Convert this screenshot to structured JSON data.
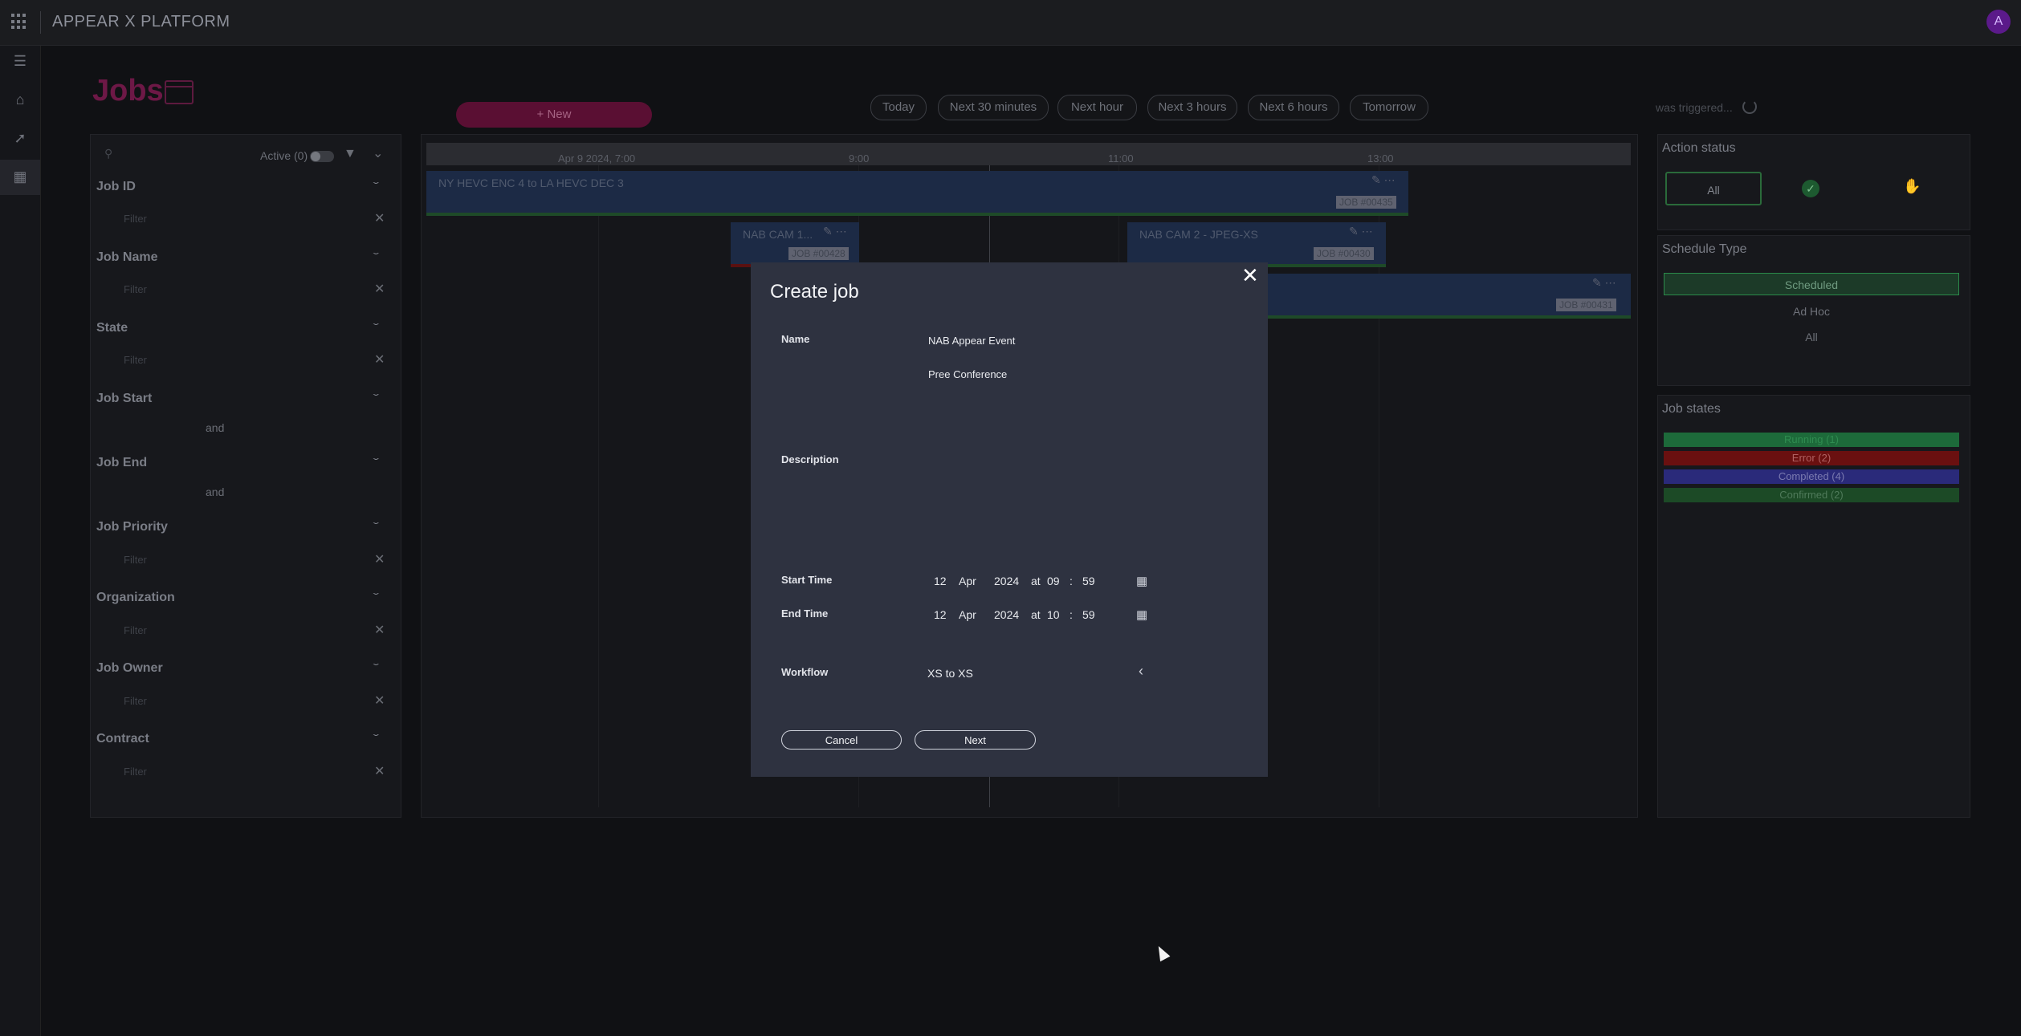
{
  "app": {
    "title": "APPEAR X PLATFORM",
    "avatar_initial": "A"
  },
  "page": {
    "title": "Jobs"
  },
  "toolbar": {
    "new_label": "+ New",
    "quick_ranges": [
      "Today",
      "Next 30 minutes",
      "Next hour",
      "Next 3 hours",
      "Next 6 hours",
      "Tomorrow"
    ],
    "triggered_text": "was triggered..."
  },
  "filters": {
    "active_label": "Active (0)",
    "placeholder": "Filter",
    "and_label": "and",
    "fields": [
      "Job ID",
      "Job Name",
      "State",
      "Job Start",
      "Job End",
      "Job Priority",
      "Organization",
      "Job Owner",
      "Contract"
    ]
  },
  "timeline": {
    "ticks": [
      "Apr 9 2024, 7:00",
      "9:00",
      "11:00",
      "13:00"
    ],
    "jobs": [
      {
        "name": "NY HEVC ENC 4 to LA HEVC DEC 3",
        "tag": "JOB #00435"
      },
      {
        "name": "NAB CAM 1...",
        "tag": "JOB #00428"
      },
      {
        "name": "NAB CAM 2 - JPEG-XS",
        "tag": "JOB #00430"
      },
      {
        "name": "",
        "tag": "JOB #00431"
      }
    ]
  },
  "right_panel": {
    "action_status": {
      "title": "Action status",
      "all_label": "All"
    },
    "schedule_type": {
      "title": "Schedule Type",
      "options": [
        "Scheduled",
        "Ad Hoc",
        "All"
      ]
    },
    "job_states": {
      "title": "Job states",
      "states": [
        {
          "label": "Running (1)",
          "color": "#1d6a3a"
        },
        {
          "label": "Error (2)",
          "color": "#6a1010"
        },
        {
          "label": "Completed (4)",
          "color": "#2a2a7a"
        },
        {
          "label": "Confirmed (2)",
          "color": "#1c4a26"
        }
      ]
    }
  },
  "modal": {
    "title": "Create job",
    "name_label": "Name",
    "name_value": "NAB Appear Event",
    "name_value_2": "Pree Conference",
    "description_label": "Description",
    "start_label": "Start Time",
    "end_label": "End Time",
    "start": {
      "day": "12",
      "month": "Apr",
      "year": "2024",
      "at": "at",
      "hour": "09",
      "sep": ":",
      "minute": "59"
    },
    "end": {
      "day": "12",
      "month": "Apr",
      "year": "2024",
      "at": "at",
      "hour": "10",
      "sep": ":",
      "minute": "59"
    },
    "workflow_label": "Workflow",
    "workflow_value": "XS to XS",
    "cancel_label": "Cancel",
    "next_label": "Next"
  }
}
